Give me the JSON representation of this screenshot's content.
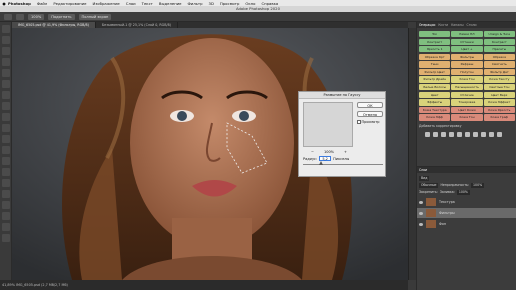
{
  "menubar": {
    "app": "Photoshop",
    "items": [
      "Файл",
      "Редактирование",
      "Изображение",
      "Слои",
      "Текст",
      "Выделение",
      "Фильтр",
      "3D",
      "Просмотр",
      "Окно",
      "Справка"
    ]
  },
  "app_title": "Adobe Photoshop 2020",
  "options_bar": {
    "zoom_value": "100%",
    "fit_label": "Подогнать",
    "fullscreen_label": "Полный экран"
  },
  "tabs": [
    {
      "label": "IMG_6505.psd @ 41,9% (Фильтры, RGB/8)",
      "active": true
    },
    {
      "label": "Безымянный-1 @ 25,1% (Слой 0, RGB/8)",
      "active": false
    }
  ],
  "dialog": {
    "title": "Размытие по Гауссу",
    "ok_label": "ОК",
    "cancel_label": "Отмена",
    "preview_label": "Просмотр",
    "zoom_value": "100%",
    "zoom_out": "−",
    "zoom_in": "+",
    "radius_label": "Радиус:",
    "radius_value": "5,2",
    "radius_unit": "Пикселы"
  },
  "status": {
    "text": "41,89%    IMG_6505.psd (2,7 Мб/2,7 Мб)"
  },
  "right_panel": {
    "actions_tabs": [
      "Операции",
      "Кисти",
      "Каналы",
      "Стили"
    ],
    "actions": [
      {
        "label": "Ton",
        "color": "g"
      },
      {
        "label": "Рамки ПЛ",
        "color": "g"
      },
      {
        "label": "Unsign & Tune",
        "color": "g"
      },
      {
        "label": "Контраст",
        "color": "g"
      },
      {
        "label": "Оттенки",
        "color": "g"
      },
      {
        "label": "Контраст",
        "color": "g"
      },
      {
        "label": "Яркость 1",
        "color": "g"
      },
      {
        "label": "Цвет +",
        "color": "g"
      },
      {
        "label": "Пресеты",
        "color": "g"
      },
      {
        "label": "Обрезка Крт",
        "color": "o"
      },
      {
        "label": "Фильтры",
        "color": "o"
      },
      {
        "label": "Обрезка",
        "color": "o"
      },
      {
        "label": "Тени",
        "color": "o"
      },
      {
        "label": "Рефреш",
        "color": "o"
      },
      {
        "label": "Смягчить",
        "color": "o"
      },
      {
        "label": "Фильтр Цвет",
        "color": "o"
      },
      {
        "label": "Полутон",
        "color": "o"
      },
      {
        "label": "Фильтр Дет",
        "color": "o"
      },
      {
        "label": "Фильтр Дрейн",
        "color": "y"
      },
      {
        "label": "Кожа Тон",
        "color": "y"
      },
      {
        "label": "Кожа Тексту",
        "color": "y"
      },
      {
        "label": "Белые Волосы",
        "color": "y"
      },
      {
        "label": "Насыщенность",
        "color": "y"
      },
      {
        "label": "Светлые Тон",
        "color": "y"
      },
      {
        "label": "Цвет",
        "color": "y"
      },
      {
        "label": "Отличие",
        "color": "y"
      },
      {
        "label": "Цвет Верх",
        "color": "y"
      },
      {
        "label": "Эффекты",
        "color": "y"
      },
      {
        "label": "Тонировка",
        "color": "y"
      },
      {
        "label": "Кожа Эффект",
        "color": "y"
      },
      {
        "label": "Кожа Текстура",
        "color": "r"
      },
      {
        "label": "Цвет Кожи",
        "color": "r"
      },
      {
        "label": "Кожа Яркость",
        "color": "r"
      },
      {
        "label": "Кожа Эфф",
        "color": "r"
      },
      {
        "label": "Кожа Тон",
        "color": "r"
      },
      {
        "label": "Кожа Граф",
        "color": "r"
      }
    ],
    "adjustments_title": "Добавить корректировку",
    "layers_tab": "Слои",
    "kind_label": "Вид",
    "blend_mode": "Обычные",
    "opacity_label": "Непрозрачность:",
    "opacity_value": "100%",
    "lock_label": "Закрепить:",
    "fill_label": "Заливка:",
    "fill_value": "100%",
    "layers": [
      {
        "name": "Текстура",
        "selected": false
      },
      {
        "name": "Фильтры",
        "selected": true
      },
      {
        "name": "Фон",
        "selected": false
      }
    ]
  }
}
